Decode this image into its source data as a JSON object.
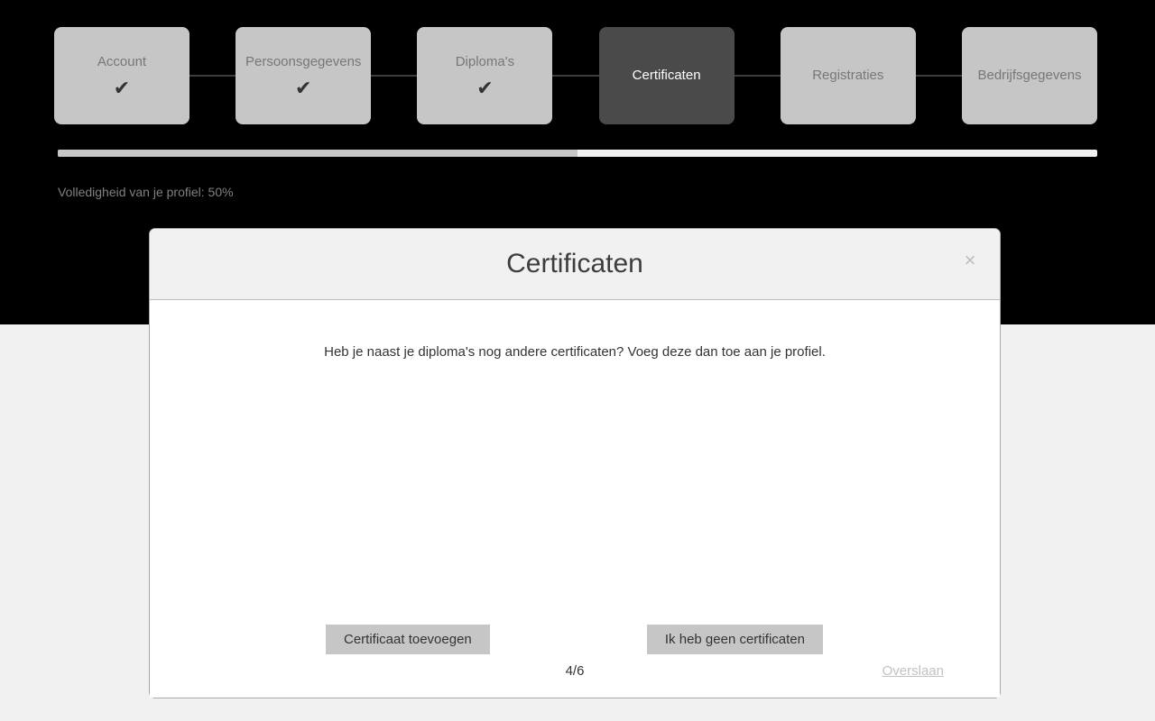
{
  "stepper": {
    "steps": [
      {
        "label": "Account",
        "state": "completed",
        "check": "✔"
      },
      {
        "label": "Persoonsgegevens",
        "state": "completed",
        "check": "✔"
      },
      {
        "label": "Diploma's",
        "state": "completed",
        "check": "✔"
      },
      {
        "label": "Certificaten",
        "state": "active",
        "check": ""
      },
      {
        "label": "Registraties",
        "state": "upcoming",
        "check": ""
      },
      {
        "label": "Bedrijfsgegevens",
        "state": "upcoming",
        "check": ""
      }
    ]
  },
  "progress": {
    "percent": 50,
    "label": "Volledigheid van je profiel: 50%",
    "fill_color": "#c6c6c6",
    "track_color": "#f1f1f1"
  },
  "modal": {
    "title": "Certificaten",
    "close_icon": "×",
    "intro": "Heb je naast je diploma's nog andere certificaten? Voeg deze dan toe aan je profiel.",
    "buttons": {
      "add": "Certificaat toevoegen",
      "none": "Ik heb geen certificaten"
    },
    "footer": {
      "page_indicator": "4/6",
      "skip_link": "Overslaan"
    }
  },
  "colors": {
    "band": "#000000",
    "page_background": "#f1f1f1",
    "step_default": "#c6c6c6",
    "step_active": "#4a4a4a",
    "connector": "#3c3c3c",
    "button": "#c6c6c6"
  }
}
